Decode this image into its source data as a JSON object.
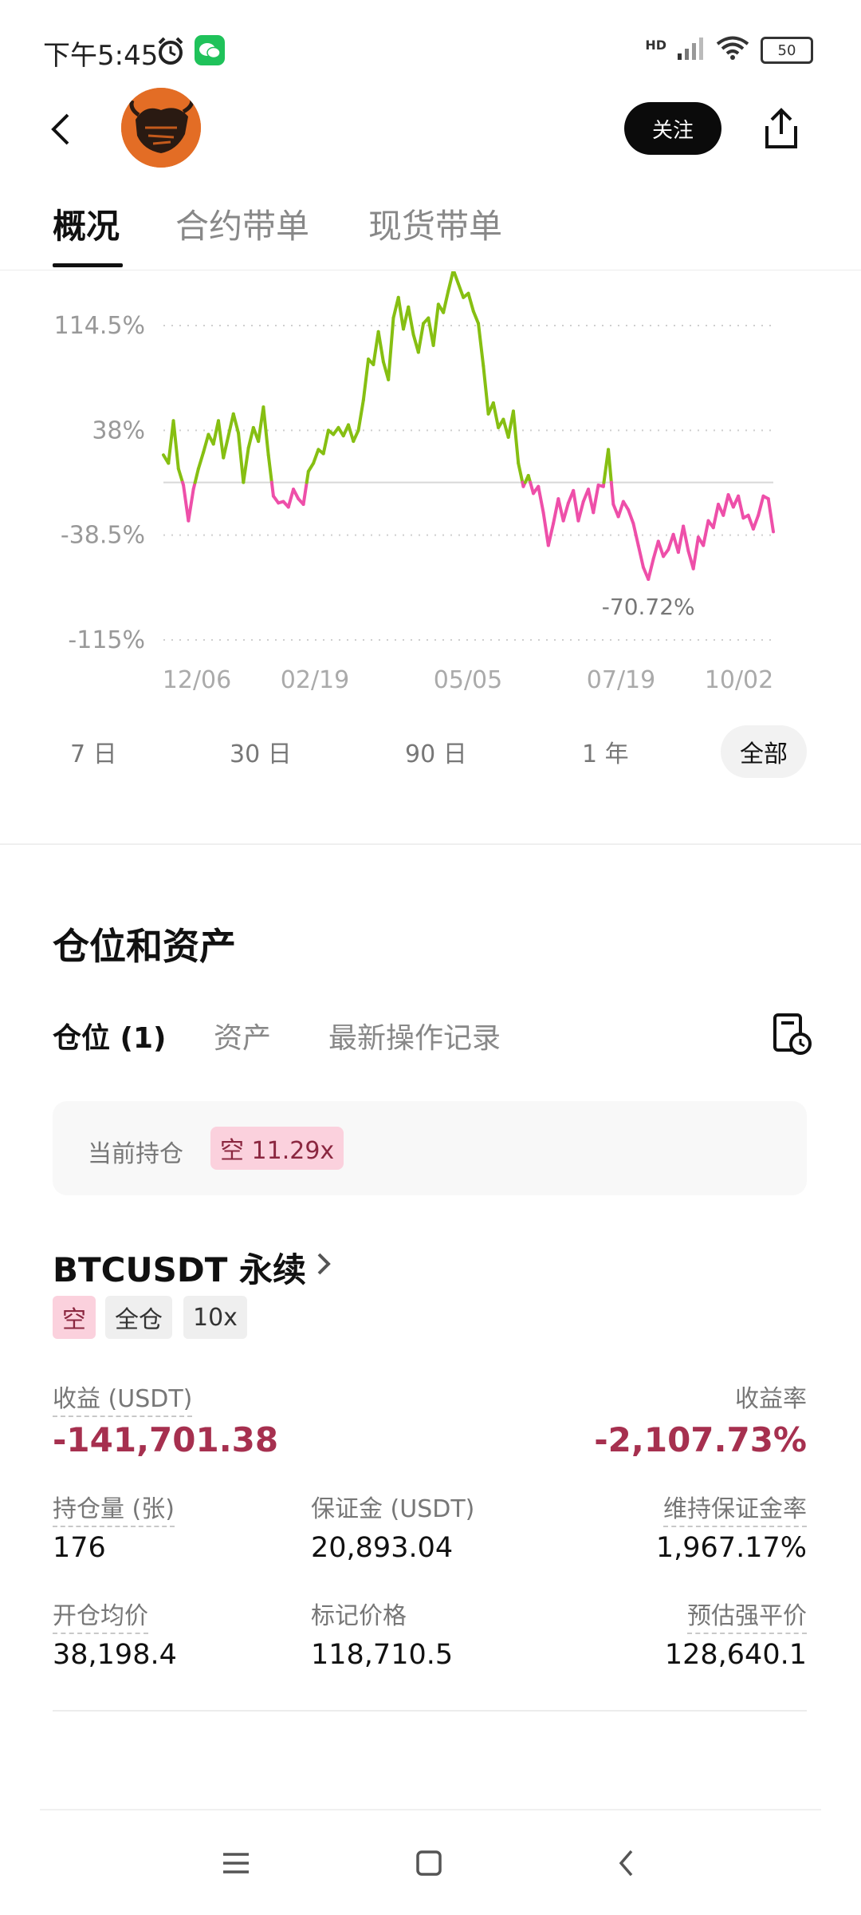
{
  "status_bar": {
    "time": "下午5:45",
    "network": "HD",
    "battery": "50"
  },
  "header": {
    "follow_label": "关注"
  },
  "tabs": [
    "概况",
    "合约带单",
    "现货带单"
  ],
  "chart_data": {
    "type": "line",
    "y_ticks": [
      "114.5%",
      "38%",
      "-38.5%",
      "-115%"
    ],
    "x_ticks": [
      "12/06",
      "02/19",
      "05/05",
      "07/19",
      "10/02"
    ],
    "ylim": [
      -115,
      114.5
    ],
    "zero_line": 0,
    "min_label": "-70.72%",
    "colors": {
      "positive": "#86bf12",
      "negative": "#ee4fa9"
    },
    "values": [
      20,
      14,
      45,
      10,
      -2,
      -28,
      -5,
      10,
      22,
      35,
      28,
      45,
      18,
      34,
      50,
      36,
      0,
      25,
      40,
      30,
      55,
      20,
      -10,
      -15,
      -14,
      -18,
      -5,
      -12,
      -16,
      8,
      14,
      24,
      21,
      38,
      35,
      40,
      34,
      42,
      30,
      38,
      60,
      90,
      86,
      110,
      88,
      75,
      120,
      135,
      112,
      128,
      108,
      95,
      116,
      120,
      100,
      130,
      124,
      140,
      155,
      145,
      135,
      138,
      125,
      116,
      85,
      50,
      58,
      40,
      46,
      33,
      52,
      14,
      -3,
      5,
      -8,
      -3,
      -22,
      -46,
      -30,
      -12,
      -28,
      -15,
      -6,
      -28,
      -14,
      -5,
      -22,
      -2,
      -3,
      24,
      -16,
      -25,
      -14,
      -20,
      -30,
      -46,
      -62,
      -70.72,
      -56,
      -43,
      -54,
      -49,
      -38,
      -51,
      -32,
      -50,
      -63,
      -40,
      -46,
      -28,
      -33,
      -16,
      -24,
      -9,
      -18,
      -10,
      -26,
      -24,
      -34,
      -24,
      -10,
      -12,
      -36
    ],
    "grid": true
  },
  "range_tabs": [
    "7 日",
    "30 日",
    "90 日",
    "1 年",
    "全部"
  ],
  "section": {
    "title": "仓位和资产",
    "sub_tabs": [
      "仓位 (1)",
      "资产",
      "最新操作记录"
    ],
    "holding_label": "当前持仓",
    "holding_badge": "空 11.29x"
  },
  "position": {
    "symbol": "BTCUSDT 永续",
    "tags": [
      "空",
      "全仓",
      "10x"
    ],
    "pnl_label": "收益 (USDT)",
    "pnl_value": "-141,701.38",
    "roi_label": "收益率",
    "roi_value": "-2,107.73%",
    "size_label": "持仓量 (张)",
    "size_value": "176",
    "margin_label": "保证金 (USDT)",
    "margin_value": "20,893.04",
    "mmr_label": "维持保证金率",
    "mmr_value": "1,967.17%",
    "entry_label": "开仓均价",
    "entry_value": "38,198.4",
    "mark_label": "标记价格",
    "mark_value": "118,710.5",
    "liq_label": "预估强平价",
    "liq_value": "128,640.1"
  }
}
